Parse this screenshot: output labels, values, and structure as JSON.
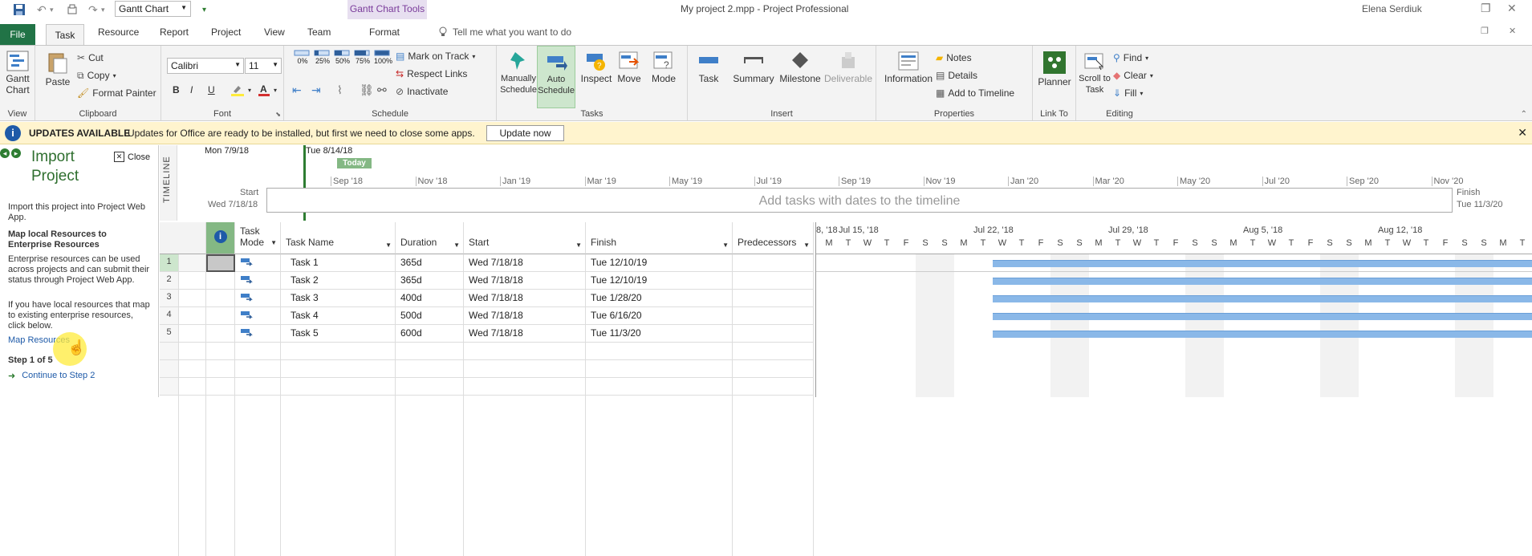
{
  "titlebar": {
    "view_selector": "Gantt Chart",
    "tool_context": "Gantt Chart Tools",
    "document_title": "My project 2.mpp  -  Project Professional",
    "user": "Elena Serdiuk"
  },
  "tabs": {
    "file": "File",
    "items": [
      "Task",
      "Resource",
      "Report",
      "Project",
      "View",
      "Team",
      "Format"
    ],
    "tellme": "Tell me what you want to do"
  },
  "ribbon": {
    "view_group": {
      "label": "View",
      "gantt_chart": "Gantt Chart"
    },
    "clipboard": {
      "label": "Clipboard",
      "paste": "Paste",
      "cut": "Cut",
      "copy": "Copy",
      "format_painter": "Format Painter"
    },
    "font": {
      "label": "Font",
      "family": "Calibri",
      "size": "11",
      "bold": "B",
      "italic": "I",
      "underline": "U"
    },
    "schedule": {
      "label": "Schedule",
      "percents": [
        "0%",
        "25%",
        "50%",
        "75%",
        "100%"
      ],
      "mark_on_track": "Mark on Track",
      "respect_links": "Respect Links",
      "inactivate": "Inactivate"
    },
    "tasks": {
      "label": "Tasks",
      "manually": "Manually Schedule",
      "auto": "Auto Schedule",
      "inspect": "Inspect",
      "move": "Move",
      "mode": "Mode"
    },
    "insert": {
      "label": "Insert",
      "task": "Task",
      "summary": "Summary",
      "milestone": "Milestone",
      "deliverable": "Deliverable"
    },
    "properties": {
      "label": "Properties",
      "information": "Information",
      "notes": "Notes",
      "details": "Details",
      "add_to_timeline": "Add to Timeline"
    },
    "linkto": {
      "label": "Link To",
      "planner": "Planner"
    },
    "editing": {
      "label": "Editing",
      "scroll_to_task": "Scroll to Task",
      "find": "Find",
      "clear": "Clear",
      "fill": "Fill"
    }
  },
  "update_bar": {
    "title": "UPDATES AVAILABLE",
    "message": "Updates for Office are ready to be installed, but first we need to close some apps.",
    "button": "Update now"
  },
  "left_pane": {
    "title": "Import Project",
    "close": "Close",
    "intro": "Import this project into Project Web App.",
    "heading": "Map local Resources to Enterprise Resources",
    "para1": "Enterprise resources can be used across projects and can submit their status through Project Web App.",
    "para2": "If you have local resources that map to existing enterprise resources, click below.",
    "link": "Map Resources",
    "step": "Step 1 of 5",
    "continue": "Continue to Step 2"
  },
  "timeline": {
    "label": "TIMELINE",
    "left_date": "Mon 7/9/18",
    "marker_date": "Tue 8/14/18",
    "today": "Today",
    "start_label": "Start",
    "start_date": "Wed 7/18/18",
    "finish_label": "Finish",
    "finish_date": "Tue 11/3/20",
    "months": [
      "Sep '18",
      "Nov '18",
      "Jan '19",
      "Mar '19",
      "May '19",
      "Jul '19",
      "Sep '19",
      "Nov '19",
      "Jan '20",
      "Mar '20",
      "May '20",
      "Jul '20",
      "Sep '20",
      "Nov '20"
    ],
    "hint": "Add tasks with dates to the timeline"
  },
  "grid": {
    "headers": {
      "mode": "Task Mode",
      "name": "Task Name",
      "duration": "Duration",
      "start": "Start",
      "finish": "Finish",
      "predecessors": "Predecessors"
    },
    "rows": [
      {
        "id": "1",
        "name": "Task 1",
        "duration": "365d",
        "start": "Wed 7/18/18",
        "finish": "Tue 12/10/19"
      },
      {
        "id": "2",
        "name": "Task 2",
        "duration": "365d",
        "start": "Wed 7/18/18",
        "finish": "Tue 12/10/19"
      },
      {
        "id": "3",
        "name": "Task 3",
        "duration": "400d",
        "start": "Wed 7/18/18",
        "finish": "Tue 1/28/20"
      },
      {
        "id": "4",
        "name": "Task 4",
        "duration": "500d",
        "start": "Wed 7/18/18",
        "finish": "Tue 6/16/20"
      },
      {
        "id": "5",
        "name": "Task 5",
        "duration": "600d",
        "start": "Wed 7/18/18",
        "finish": "Tue 11/3/20"
      }
    ]
  },
  "gantt": {
    "weeks": [
      "8, '18",
      "Jul 15, '18",
      "Jul 22, '18",
      "Jul 29, '18",
      "Aug 5, '18",
      "Aug 12, '18"
    ],
    "days": [
      "M",
      "T",
      "W",
      "T",
      "F",
      "S",
      "S",
      "M",
      "T",
      "W",
      "T",
      "F",
      "S",
      "S",
      "M",
      "T",
      "W",
      "T",
      "F",
      "S",
      "S",
      "M",
      "T",
      "W",
      "T",
      "F",
      "S",
      "S",
      "M",
      "T",
      "W",
      "T",
      "F",
      "S",
      "S",
      "M",
      "T"
    ]
  },
  "colors": {
    "accent": "#217346",
    "bar": "#8ab8e8",
    "update_bg": "#fff4ce",
    "tool_tab": "#7a3b9a"
  }
}
